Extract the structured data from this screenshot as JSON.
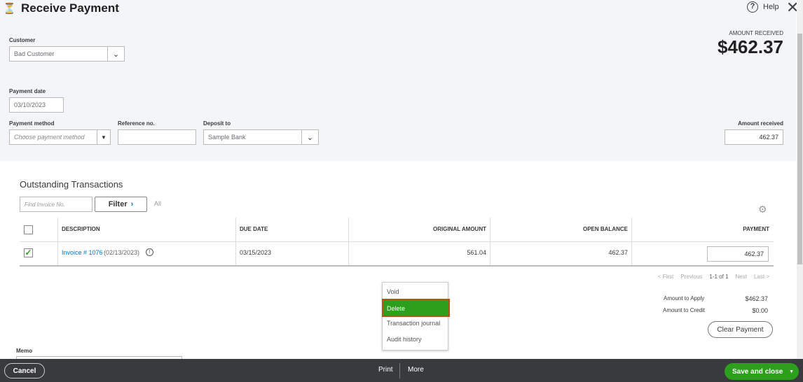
{
  "header": {
    "title": "Receive Payment",
    "help": "Help"
  },
  "form": {
    "customer_label": "Customer",
    "customer_value": "Bad Customer",
    "payment_date_label": "Payment date",
    "payment_date": "03/10/2023",
    "payment_method_label": "Payment method",
    "payment_method_placeholder": "Choose payment method",
    "reference_label": "Reference no.",
    "reference_value": "",
    "deposit_label": "Deposit to",
    "deposit_value": "Sample Bank",
    "amount_received_top_label": "AMOUNT RECEIVED",
    "amount_received_big": "$462.37",
    "amount_received_label": "Amount received",
    "amount_received_value": "462.37"
  },
  "outstanding": {
    "title": "Outstanding Transactions",
    "find_placeholder": "Find Invoice No.",
    "filter": "Filter",
    "filter_all": "All",
    "columns": [
      "DESCRIPTION",
      "DUE DATE",
      "ORIGINAL AMOUNT",
      "OPEN BALANCE",
      "PAYMENT"
    ],
    "rows": [
      {
        "checked": true,
        "invoice_link": "Invoice # 1076",
        "invoice_date": "(02/13/2023)",
        "due_date": "03/15/2023",
        "original_amount": "561.04",
        "open_balance": "462.37",
        "payment": "462.37"
      }
    ],
    "pager": {
      "first": "< First",
      "previous": "Previous",
      "range": "1-1 of 1",
      "next": "Next",
      "last": "Last >"
    }
  },
  "totals": {
    "apply_label": "Amount to Apply",
    "apply_value": "$462.37",
    "credit_label": "Amount to Credit",
    "credit_value": "$0.00",
    "clear": "Clear Payment"
  },
  "memo_label": "Memo",
  "more_menu": {
    "items": [
      "Void",
      "Delete",
      "Transaction journal",
      "Audit history"
    ],
    "highlighted": "Delete"
  },
  "footer": {
    "cancel": "Cancel",
    "print": "Print",
    "more": "More",
    "save": "Save and close"
  },
  "colors": {
    "accent": "#2ca01c",
    "link": "#0077c5",
    "highlight_border": "#b5541a",
    "footer": "#393a3d"
  }
}
